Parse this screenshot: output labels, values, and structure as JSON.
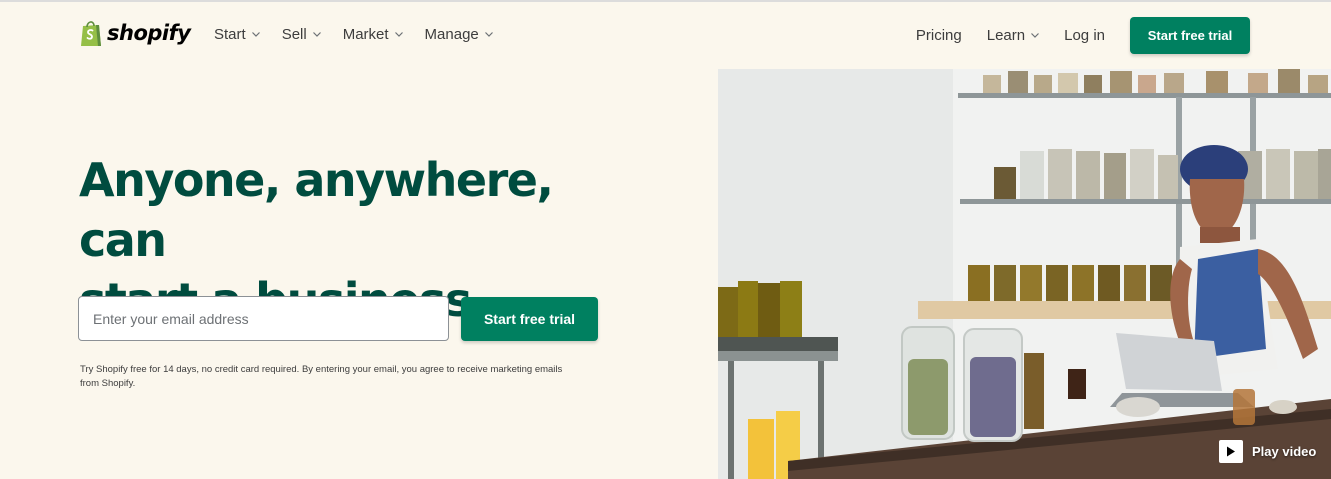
{
  "brand": {
    "name": "shopify",
    "color": "#95bf47"
  },
  "nav": {
    "items": [
      {
        "label": "Start"
      },
      {
        "label": "Sell"
      },
      {
        "label": "Market"
      },
      {
        "label": "Manage"
      }
    ],
    "pricing": "Pricing",
    "learn": "Learn",
    "login": "Log in",
    "cta": "Start free trial"
  },
  "hero": {
    "title_line1": "Anyone, anywhere, can",
    "title_line2": "start a business",
    "email_placeholder": "Enter your email address",
    "cta": "Start free trial",
    "disclaimer": "Try Shopify free for 14 days, no credit card required. By entering your email, you agree to receive marketing emails from Shopify."
  },
  "video": {
    "label": "Play video"
  },
  "colors": {
    "accent": "#008060",
    "heading": "#004c3f",
    "background": "#fbf7ed"
  }
}
